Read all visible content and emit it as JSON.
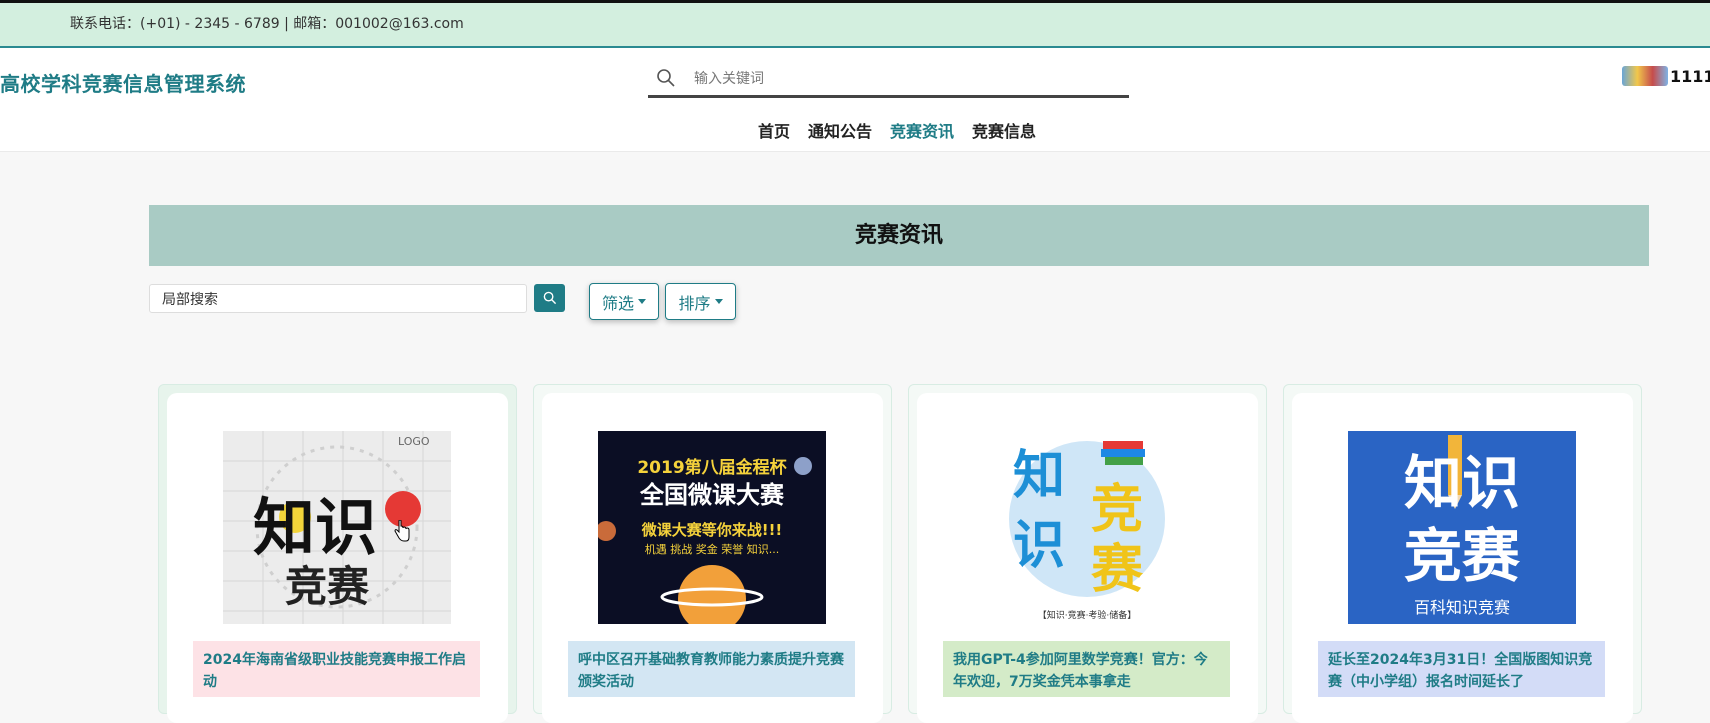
{
  "topbar": {
    "contact": "联系电话：(+01) - 2345 - 6789 | 邮箱：001002@163.com"
  },
  "header": {
    "site_title": "高校学科竞赛信息管理系统",
    "search_placeholder": "输入关键词",
    "username": "1111"
  },
  "nav": {
    "items": [
      {
        "label": "首页"
      },
      {
        "label": "通知公告"
      },
      {
        "label": "竞赛资讯"
      },
      {
        "label": "竞赛信息"
      }
    ],
    "active": "竞赛资讯"
  },
  "banner": {
    "title": "竞赛资讯"
  },
  "filters": {
    "local_search_placeholder": "局部搜索",
    "filter_label": "筛选",
    "sort_label": "排序"
  },
  "cards": [
    {
      "caption": "2024年海南省级职业技能竞赛申报工作启动",
      "caption_bg": "#fde2e6",
      "image": {
        "logo": "LOGO",
        "line1": "知识",
        "line2": "竞赛"
      }
    },
    {
      "caption": "呼中区召开基础教育教师能力素质提升竞赛颁奖活动",
      "caption_bg": "#d3e6f3",
      "image": {
        "year": "2019第八届金程杯",
        "title": "全国微课大赛",
        "sub": "微课大赛等你来战!!!",
        "tags": "机遇 挑战 奖金 荣誉 知识..."
      }
    },
    {
      "caption": "我用GPT-4参加阿里数学竞赛！官方：今年欢迎，7万奖金凭本事拿走",
      "caption_bg": "#d4ebc8",
      "image": {
        "line1": "知",
        "line2": "识",
        "line3": "竞",
        "line4": "赛",
        "footer": "【知识·竞赛·考验·储备】"
      }
    },
    {
      "caption": "延长至2024年3月31日！全国版图知识竞赛（中小学组）报名时间延长了",
      "caption_bg": "#d3dcf7",
      "image": {
        "line1": "知识",
        "line2": "竞赛",
        "footer": "百科知识竞赛"
      }
    }
  ],
  "colors": {
    "accent": "#1f7c86",
    "banner": "#a9cbc4",
    "topbar": "#d3efdf"
  }
}
